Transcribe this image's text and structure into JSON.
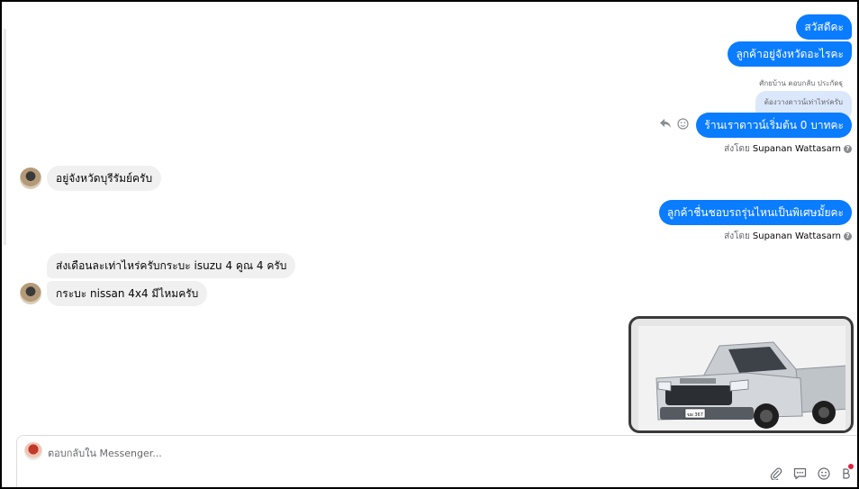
{
  "conversation": {
    "outgoing_1": "สวัสดีคะ",
    "outgoing_2": "ลูกค้าอยู่จังหวัดอะไรคะ",
    "reply_meta": "ศักยบ้าน ตอบกลับ ประกัดฐุ",
    "reply_quote": "ต้องวางดาวน์เท่าไหร่ครับ",
    "outgoing_3": "ร้านเราดาวน์เริ่มต้น 0 บาทคะ",
    "sent_by_label": "ส่งโดย",
    "sent_by_name": "Supanan Wattasarn",
    "incoming_1": "อยู่จังหวัดบุรีรัมย์ครับ",
    "outgoing_4": "ลูกค้าชื่นชอบรถรุ่นไหนเป็นพิเศษมั้ยคะ",
    "sent_by_label_2": "ส่งโดย",
    "sent_by_name_2": "Supanan Wattasarn",
    "incoming_2": "ส่งเดือนละเท่าไหร่ครับกระบะ isuzu 4 คูณ 4 ครับ",
    "incoming_3": "กระบะ nissan 4x4 มีไหมครับ",
    "truck_plate": "ฆผ 367"
  },
  "composer": {
    "placeholder": "ตอบกลับใน Messenger..."
  },
  "icons": {
    "reply": "reply-icon",
    "react": "emoji-icon",
    "attach": "paperclip-icon",
    "saved_replies": "saved-replies-icon",
    "emoji": "emoji-icon",
    "extra": "more-icon"
  },
  "colors": {
    "outgoing_bubble": "#0a7cff",
    "incoming_bubble": "#f0f0f0",
    "notification_dot": "#e41e3f"
  }
}
